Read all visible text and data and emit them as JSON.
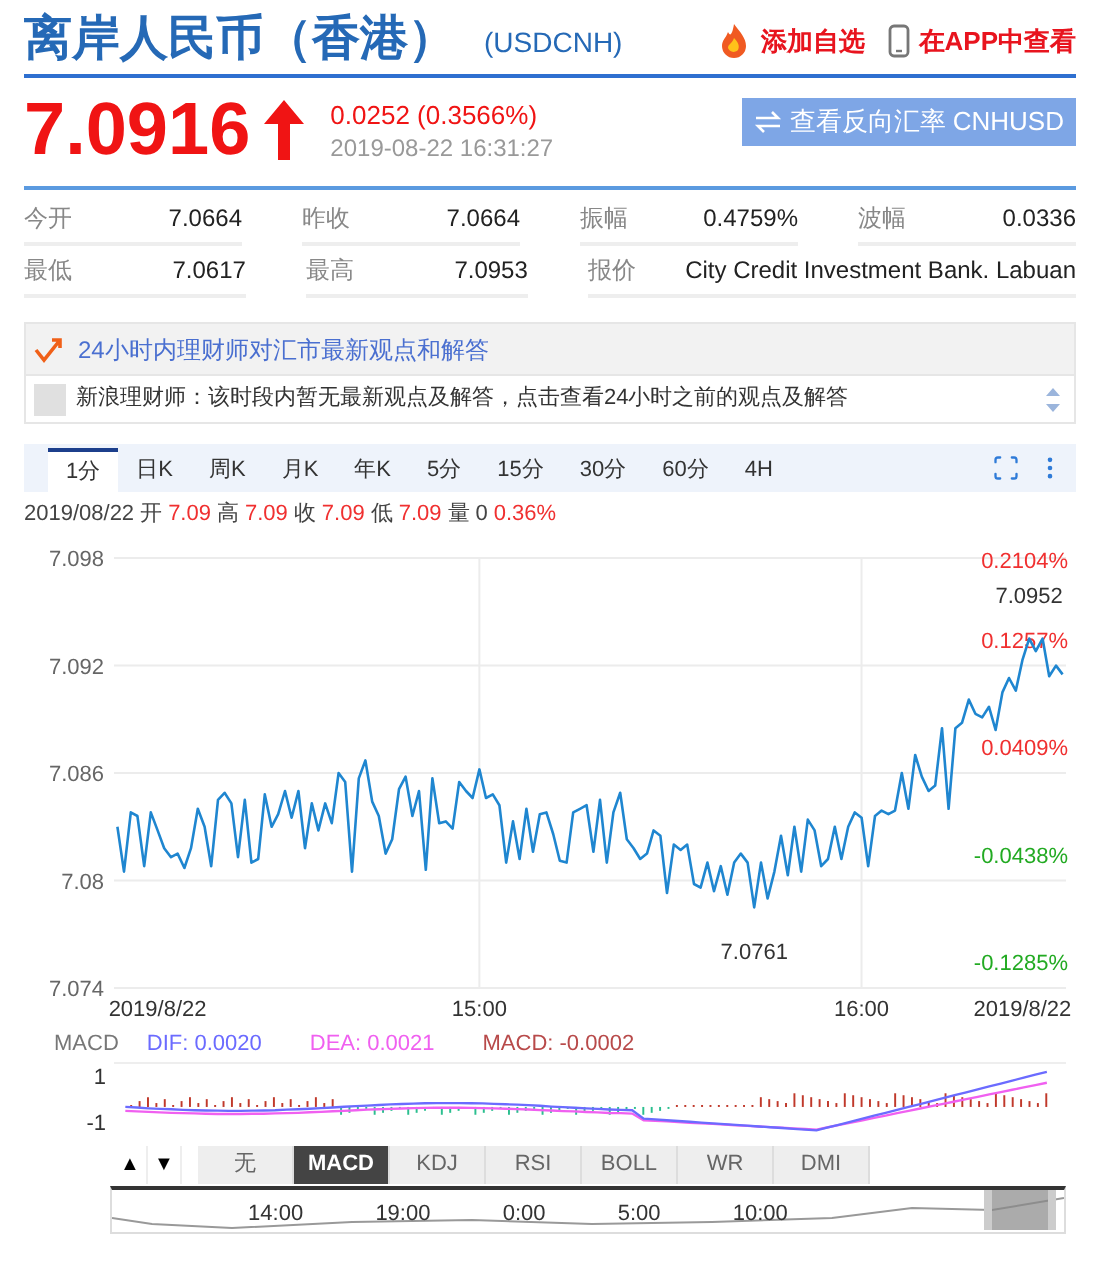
{
  "header": {
    "title": "离岸人民币（香港）",
    "code": "(USDCNH)",
    "actions": [
      {
        "kind": "fire",
        "label": "添加自选"
      },
      {
        "kind": "phone",
        "label": "在APP中查看"
      }
    ]
  },
  "quote": {
    "price": "7.0916",
    "change": "0.0252 (0.3566%)",
    "time": "2019-08-22 16:31:27",
    "reverse_button": "查看反向汇率 CNHUSD"
  },
  "stats": [
    [
      {
        "kind": "normal",
        "label": "今开",
        "value": "7.0664"
      },
      {
        "kind": "normal",
        "label": "昨收",
        "value": "7.0664"
      },
      {
        "kind": "normal",
        "label": "振幅",
        "value": "0.4759%"
      },
      {
        "kind": "normal",
        "label": "波幅",
        "value": "0.0336"
      }
    ],
    [
      {
        "kind": "normal",
        "label": "最低",
        "value": "7.0617"
      },
      {
        "kind": "normal",
        "label": "最高",
        "value": "7.0953"
      },
      {
        "kind": "wide",
        "label": "报价",
        "value": "City Credit Investment Bank. Labuan"
      }
    ]
  ],
  "advisor": {
    "title": "24小时内理财师对汇市最新观点和解答",
    "message": "新浪理财师：该时段内暂无最新观点及解答，点击查看24小时之前的观点及解答"
  },
  "period_tabs": [
    {
      "label": "1分",
      "selected": true
    },
    {
      "label": "日K",
      "selected": false
    },
    {
      "label": "周K",
      "selected": false
    },
    {
      "label": "月K",
      "selected": false
    },
    {
      "label": "年K",
      "selected": false
    },
    {
      "label": "5分",
      "selected": false
    },
    {
      "label": "15分",
      "selected": false
    },
    {
      "label": "30分",
      "selected": false
    },
    {
      "label": "60分",
      "selected": false
    },
    {
      "label": "4H",
      "selected": false
    }
  ],
  "bar_info": [
    {
      "kind": "plain",
      "text": "2019/08/22"
    },
    {
      "kind": "plain",
      "text": "开"
    },
    {
      "kind": "price",
      "text": "7.09"
    },
    {
      "kind": "plain",
      "text": "高"
    },
    {
      "kind": "price",
      "text": "7.09"
    },
    {
      "kind": "plain",
      "text": "收"
    },
    {
      "kind": "price",
      "text": "7.09"
    },
    {
      "kind": "plain",
      "text": "低"
    },
    {
      "kind": "price",
      "text": "7.09"
    },
    {
      "kind": "plain",
      "text": "量"
    },
    {
      "kind": "plain",
      "text": "0"
    },
    {
      "kind": "price",
      "text": "0.36%"
    }
  ],
  "chart": {
    "chart_data": {
      "type": "line",
      "grid": true,
      "categories": [
        null,
        null,
        null,
        null,
        null,
        null,
        "2019/8/22",
        null,
        null,
        null,
        null,
        null,
        null,
        null,
        null,
        null,
        null,
        null,
        null,
        null,
        null,
        null,
        null,
        null,
        null,
        null,
        null,
        null,
        null,
        null,
        null,
        null,
        null,
        null,
        null,
        null,
        null,
        null,
        null,
        null,
        null,
        null,
        null,
        null,
        null,
        null,
        null,
        null,
        null,
        null,
        null,
        null,
        null,
        null,
        "15:00",
        null,
        null,
        null,
        null,
        null,
        null,
        null,
        null,
        null,
        null,
        null,
        null,
        null,
        null,
        null,
        null,
        null,
        null,
        null,
        null,
        null,
        null,
        null,
        null,
        null,
        null,
        null,
        null,
        null,
        null,
        null,
        null,
        null,
        null,
        null,
        null,
        null,
        null,
        null,
        null,
        null,
        null,
        null,
        null,
        null,
        null,
        null,
        null,
        null,
        null,
        null,
        null,
        null,
        null,
        null,
        null,
        "16:00",
        null,
        null,
        null,
        null,
        null,
        null,
        null,
        null,
        null,
        null,
        null,
        null,
        null,
        null,
        null,
        null,
        null,
        null,
        null,
        null,
        null,
        null,
        null,
        "2019/8/22",
        null,
        null,
        null,
        null,
        null,
        null
      ],
      "ylim": [
        7.074,
        7.098
      ],
      "yticks": [
        7.074,
        {
          "value": 7.08,
          "label": "7.08"
        },
        7.086,
        7.092,
        7.098
      ],
      "series": [
        {
          "color": "#1f86d0",
          "values": [
            7.083,
            7.0805,
            7.0838,
            7.0836,
            7.0808,
            7.0838,
            7.0828,
            7.0818,
            7.0813,
            7.0815,
            7.0807,
            7.0818,
            7.084,
            7.083,
            7.0808,
            7.0845,
            7.0849,
            7.0843,
            7.0813,
            7.0845,
            7.081,
            7.0812,
            7.0848,
            7.083,
            7.0837,
            7.085,
            7.0835,
            7.085,
            7.0818,
            7.0843,
            7.0828,
            7.0843,
            7.0832,
            7.086,
            7.0855,
            7.0805,
            7.0857,
            7.0867,
            7.0844,
            7.0836,
            7.0815,
            7.0823,
            7.0851,
            7.0858,
            7.0836,
            7.085,
            7.0806,
            7.0857,
            7.0832,
            7.0833,
            7.0829,
            7.0855,
            7.085,
            7.0846,
            7.0862,
            7.0846,
            7.0848,
            7.0842,
            7.081,
            7.0833,
            7.0812,
            7.084,
            7.0816,
            7.0837,
            7.0838,
            7.0826,
            7.0811,
            7.081,
            7.0838,
            7.084,
            7.0842,
            7.0816,
            7.0845,
            7.081,
            7.0838,
            7.0849,
            7.0823,
            7.0818,
            7.0812,
            7.0815,
            7.0828,
            7.0825,
            7.0793,
            7.082,
            7.0817,
            7.082,
            7.0798,
            7.0796,
            7.081,
            7.0794,
            7.0808,
            7.0792,
            7.081,
            7.0815,
            7.081,
            7.0785,
            7.081,
            7.079,
            7.0805,
            7.0825,
            7.0803,
            7.083,
            7.0805,
            7.0834,
            7.0828,
            7.0808,
            7.0812,
            7.083,
            7.0812,
            7.083,
            7.0838,
            7.0835,
            7.0808,
            7.0836,
            7.0839,
            7.0837,
            7.0839,
            7.086,
            7.084,
            7.087,
            7.0858,
            7.085,
            7.0853,
            7.0885,
            7.084,
            7.0885,
            7.0888,
            7.0901,
            7.0893,
            7.0891,
            7.0897,
            7.0884,
            7.0905,
            7.0913,
            7.0906,
            7.0923,
            7.0935,
            7.0928,
            7.0935,
            7.0914,
            7.092,
            7.0915
          ]
        }
      ],
      "annotations": [
        "7.0952",
        "7.0761"
      ]
    },
    "percent_axis": [
      {
        "kind": "up",
        "label": "0.2104%"
      },
      {
        "kind": "up",
        "label": "0.1257%"
      },
      {
        "kind": "up",
        "label": "0.0409%"
      },
      {
        "kind": "down",
        "label": "-0.0438%"
      },
      {
        "kind": "down",
        "label": "-0.1285%"
      }
    ]
  },
  "macd": {
    "title": "MACD",
    "legend": [
      {
        "label": "DIF: 0.0020",
        "color": "#6b6bff"
      },
      {
        "label": "DEA: 0.0021",
        "color": "#f060f0"
      },
      {
        "label": "MACD: -0.0002",
        "color": "#b84a4a"
      }
    ],
    "axis": [
      "1",
      "-1"
    ]
  },
  "indicator_tabs": [
    {
      "label": "无",
      "selected": false
    },
    {
      "label": "MACD",
      "selected": true
    },
    {
      "label": "KDJ",
      "selected": false
    },
    {
      "label": "RSI",
      "selected": false
    },
    {
      "label": "BOLL",
      "selected": false
    },
    {
      "label": "WR",
      "selected": false
    },
    {
      "label": "DMI",
      "selected": false
    }
  ],
  "scroll_buttons": [
    "▲",
    "▼"
  ],
  "navigator": {
    "labels": [
      "14:00",
      "19:00",
      "0:00",
      "5:00",
      "10:00"
    ]
  }
}
